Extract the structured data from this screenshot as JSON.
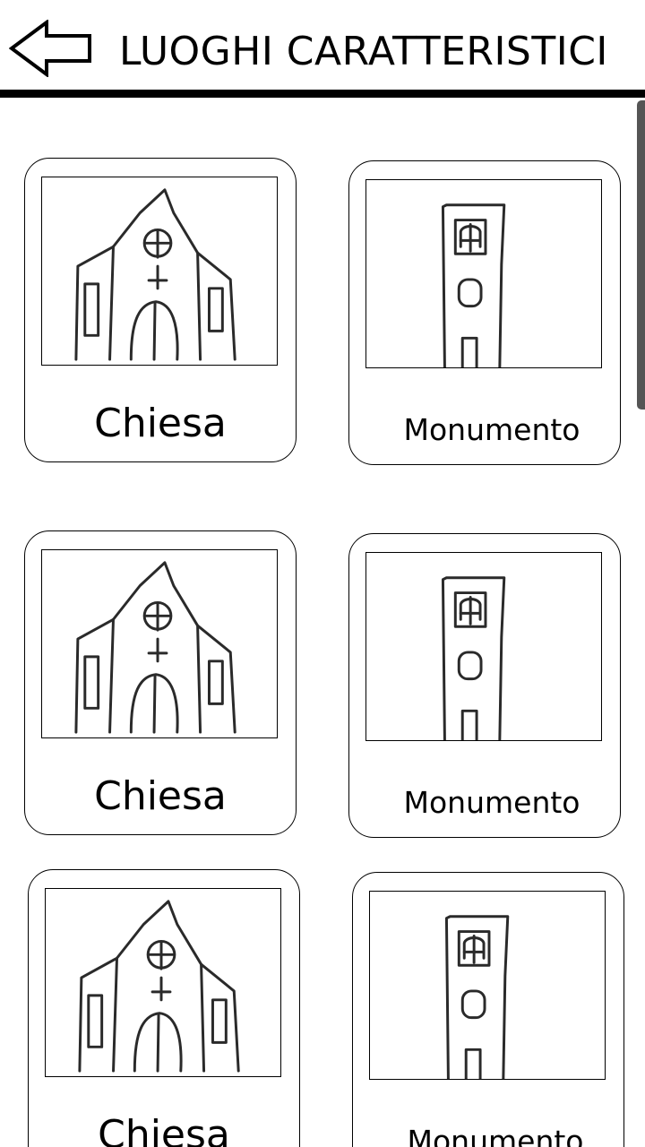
{
  "header": {
    "title": "LUOGHI CARATTERISTICI",
    "back_icon": "arrow-left-icon"
  },
  "cards": [
    {
      "label": "Chiesa",
      "icon": "church-sketch"
    },
    {
      "label": "Monumento",
      "icon": "tower-sketch"
    },
    {
      "label": "Chiesa",
      "icon": "church-sketch"
    },
    {
      "label": "Monumento",
      "icon": "tower-sketch"
    },
    {
      "label": "Chiesa",
      "icon": "church-sketch"
    },
    {
      "label": "Monumento",
      "icon": "tower-sketch"
    }
  ]
}
